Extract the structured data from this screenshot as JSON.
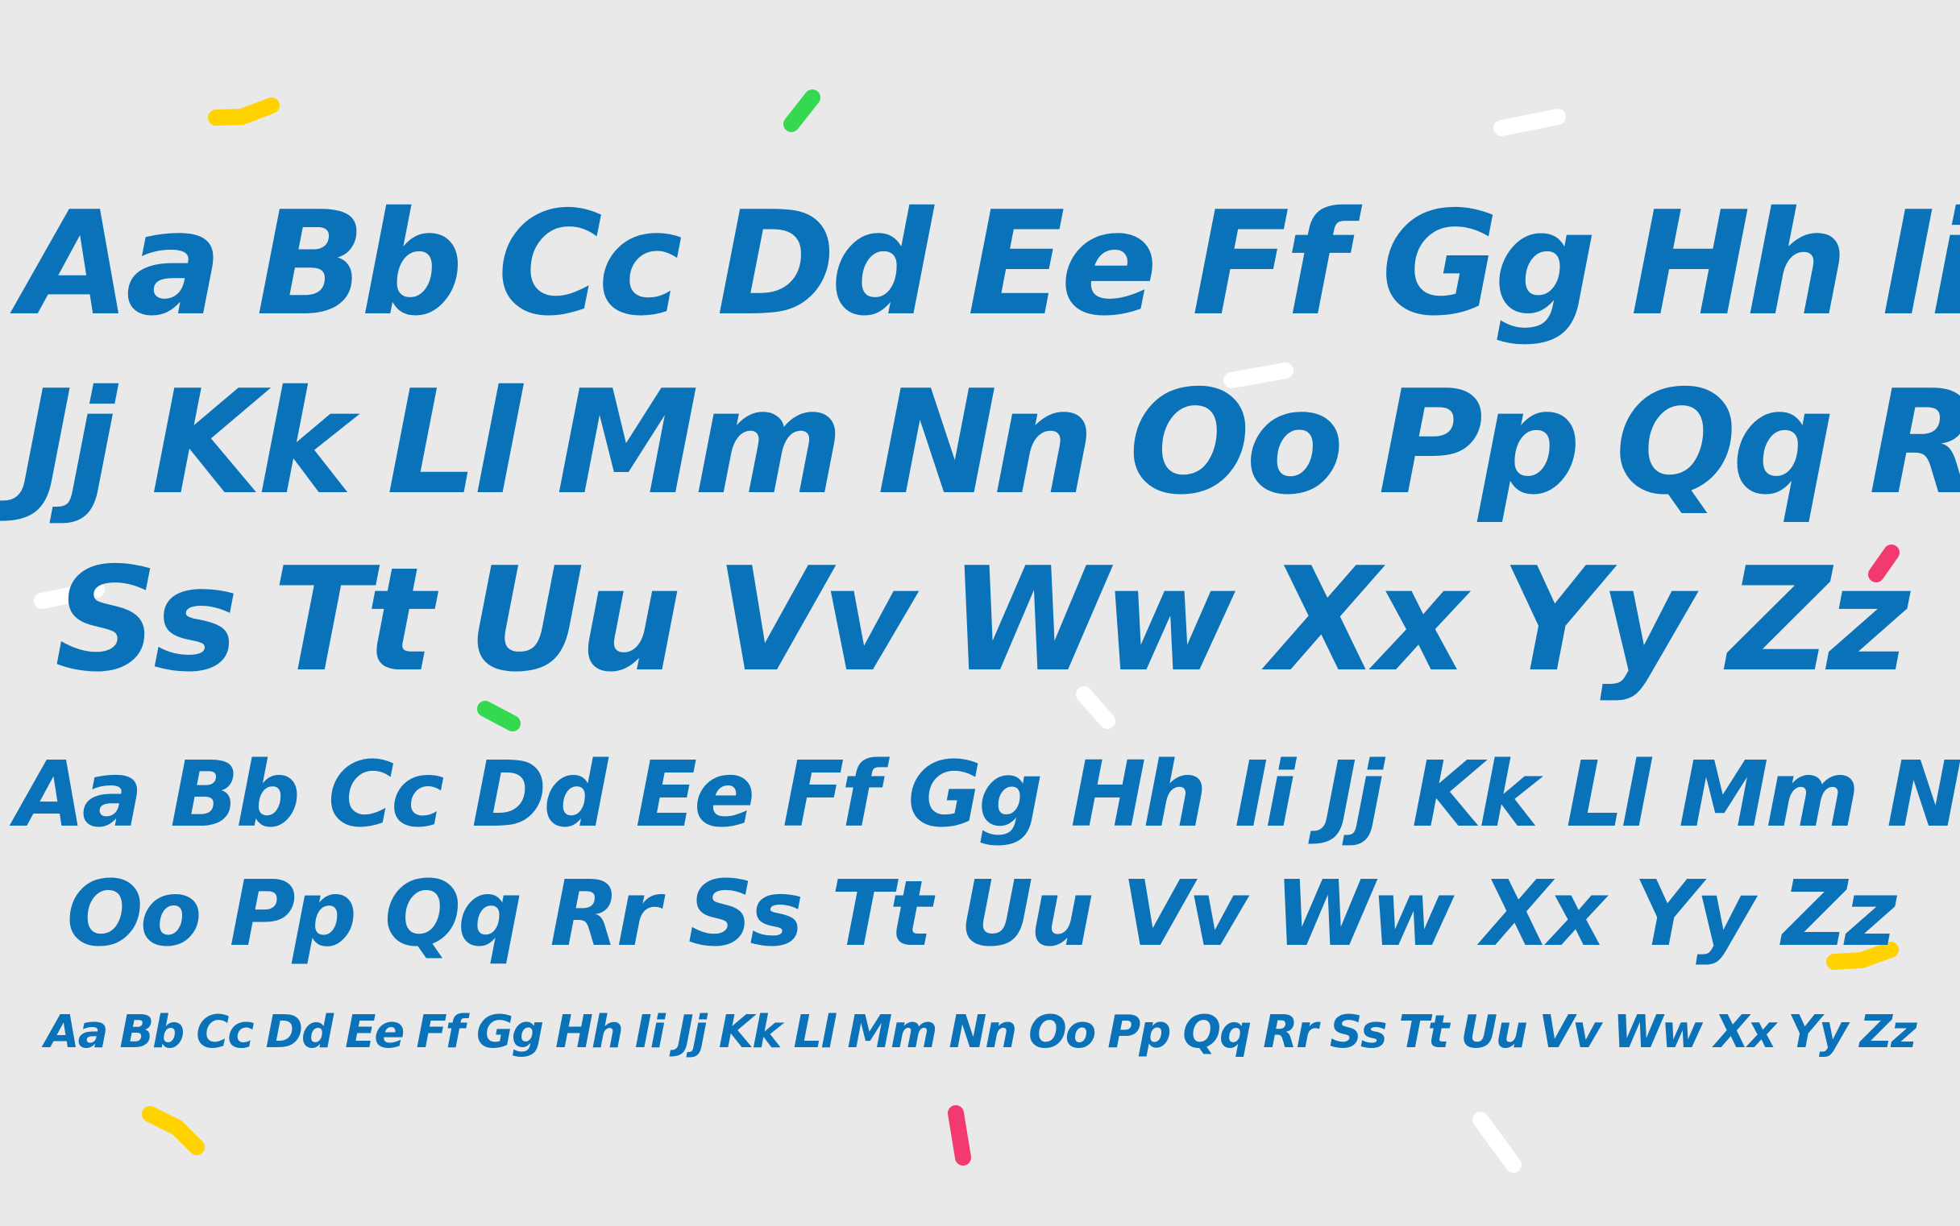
{
  "colors": {
    "background": "#e9e9e9",
    "letters": "#0a72b8",
    "confetti_yellow": "#ffd200",
    "confetti_green": "#35d94f",
    "confetti_pink": "#f23a70",
    "confetti_white": "#ffffff"
  },
  "large": {
    "row1": [
      "Aa",
      "Bb",
      "Cc",
      "Dd",
      "Ee",
      "Ff",
      "Gg",
      "Hh",
      "Ii"
    ],
    "row2": [
      "Jj",
      "Kk",
      "Ll",
      "Mm",
      "Nn",
      "Oo",
      "Pp",
      "Qq",
      "Rr"
    ],
    "row3": [
      "Ss",
      "Tt",
      "Uu",
      "Vv",
      "Ww",
      "Xx",
      "Yy",
      "Zz"
    ]
  },
  "medium": {
    "row1": [
      "Aa",
      "Bb",
      "Cc",
      "Dd",
      "Ee",
      "Ff",
      "Gg",
      "Hh",
      "Ii",
      "Jj",
      "Kk",
      "Ll",
      "Mm",
      "Nn"
    ],
    "row2": [
      "Oo",
      "Pp",
      "Qq",
      "Rr",
      "Ss",
      "Tt",
      "Uu",
      "Vv",
      "Ww",
      "Xx",
      "Yy",
      "Zz"
    ]
  },
  "small": {
    "row1": [
      "Aa",
      "Bb",
      "Cc",
      "Dd",
      "Ee",
      "Ff",
      "Gg",
      "Hh",
      "Ii",
      "Jj",
      "Kk",
      "Ll",
      "Mm",
      "Nn",
      "Oo",
      "Pp",
      "Qq",
      "Rr",
      "Ss",
      "Tt",
      "Uu",
      "Vv",
      "Ww",
      "Xx",
      "Yy",
      "Zz"
    ]
  }
}
